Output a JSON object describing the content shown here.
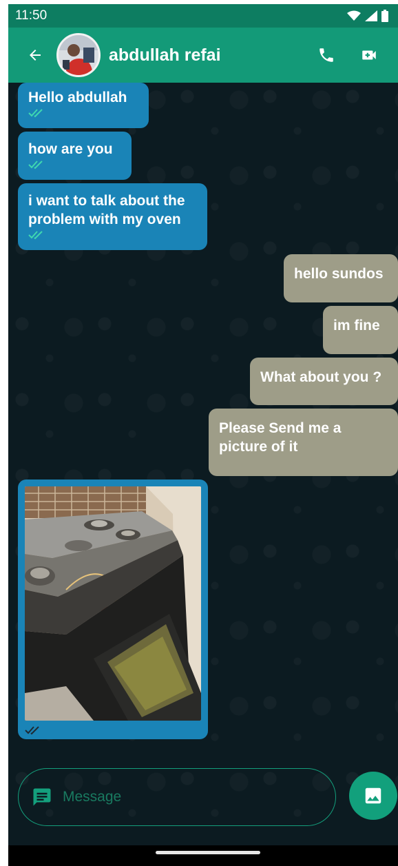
{
  "status_bar": {
    "time": "11:50",
    "icons": [
      "wifi-icon",
      "signal-icon",
      "battery-icon"
    ]
  },
  "header": {
    "contact_name": "abdullah refai",
    "back_icon": "arrow-left-icon",
    "actions": [
      "phone-icon",
      "video-call-icon"
    ],
    "color": "#139a78",
    "status_color": "#0d7d61"
  },
  "messages": [
    {
      "direction": "incoming",
      "text": "Hello abdullah",
      "status": "read"
    },
    {
      "direction": "incoming",
      "text": "how are you",
      "status": "read"
    },
    {
      "direction": "incoming",
      "text": "i want to talk about the problem with my oven",
      "status": "read"
    },
    {
      "direction": "outgoing",
      "text": "hello sundos"
    },
    {
      "direction": "outgoing",
      "text": "im fine"
    },
    {
      "direction": "outgoing",
      "text": "What about you ?"
    },
    {
      "direction": "outgoing",
      "text": "Please Send me a picture of it"
    },
    {
      "direction": "incoming",
      "type": "image",
      "image": "photo of an opened oven",
      "status": "sent"
    }
  ],
  "composer": {
    "placeholder": "Message",
    "left_icon": "message-icon",
    "send_icon": "image-icon"
  },
  "colors": {
    "incoming_bubble": "#1a84b7",
    "outgoing_bubble": "#9e9d88",
    "background": "#0c1b21",
    "accent": "#12a07c",
    "read_ticks": "#3fd8b0"
  }
}
